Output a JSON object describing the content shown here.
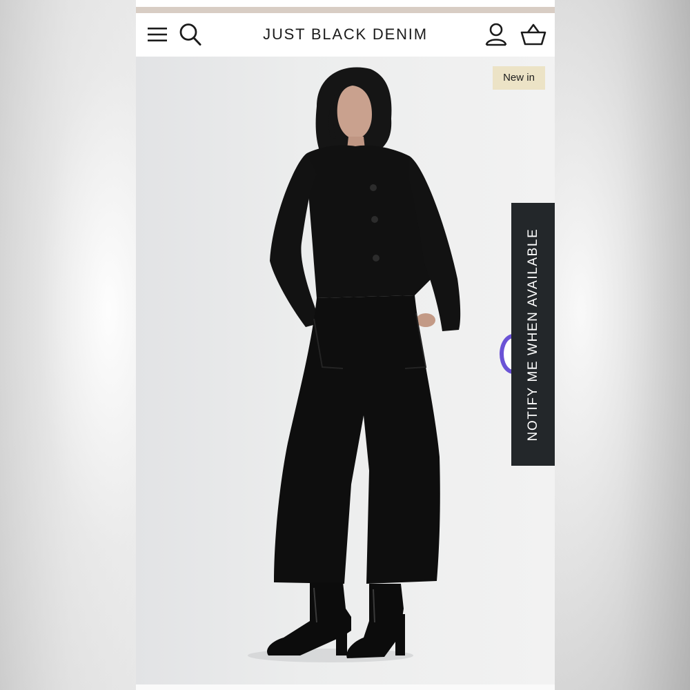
{
  "header": {
    "brand": "JUST BLACK DENIM",
    "icons": [
      "menu-icon",
      "search-icon",
      "account-icon",
      "basket-icon"
    ]
  },
  "product": {
    "badge": "New in",
    "image_subject": "model wearing black collarless jacket and black wide-leg cropped jeans with black heeled boots"
  },
  "notify": {
    "label": "NOTIFY ME WHEN AVAILABLE"
  },
  "colors": {
    "accent_strip": "#d8cdc4",
    "badge_bg": "#ece3c6",
    "notify_bg": "#23272a",
    "widget_accent": "#6b53d6"
  }
}
